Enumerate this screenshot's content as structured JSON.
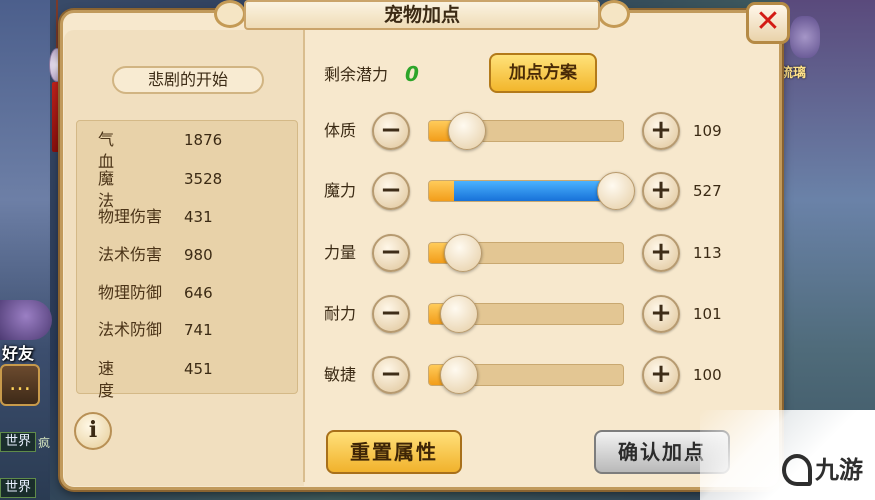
{
  "title": "宠物加点",
  "pet_name": "悲剧的开始",
  "stats": [
    {
      "label": "气血",
      "value": "1876"
    },
    {
      "label": "魔法",
      "value": "3528"
    },
    {
      "label": "物理伤害",
      "value": "431"
    },
    {
      "label": "法术伤害",
      "value": "980"
    },
    {
      "label": "物理防御",
      "value": "646"
    },
    {
      "label": "法术防御",
      "value": "741"
    },
    {
      "label": "速度",
      "value": "451"
    }
  ],
  "remaining_points": {
    "label": "剩余潜力",
    "value": "0"
  },
  "plan_button": "加点方案",
  "attributes": [
    {
      "label": "体质",
      "value": "109",
      "level": 0.2,
      "pending": 0
    },
    {
      "label": "魔力",
      "value": "527",
      "level": 0.96,
      "pending": 0.83
    },
    {
      "label": "力量",
      "value": "113",
      "level": 0.18,
      "pending": 0
    },
    {
      "label": "耐力",
      "value": "101",
      "level": 0.16,
      "pending": 0
    },
    {
      "label": "敏捷",
      "value": "100",
      "level": 0.16,
      "pending": 0
    }
  ],
  "reset_button": "重置属性",
  "confirm_button": "确认加点",
  "side_ui": {
    "friend_label": "好友",
    "world_tag": "世界",
    "chat_snippet": "疯",
    "right_name": "琉璃"
  },
  "watermark": "九游",
  "colors": {
    "panel_bg": "#f7e8cd",
    "accent_gold": "#f2b62c",
    "slider_orange": "#f29d1a",
    "slider_blue": "#1771d8",
    "remaining_green": "#2da52a",
    "close_red": "#d31b14"
  },
  "icons": {
    "close": "close-x-icon",
    "info": "info-icon",
    "minus": "minus-icon",
    "plus": "plus-icon",
    "chat": "chat-bubble-icon"
  }
}
